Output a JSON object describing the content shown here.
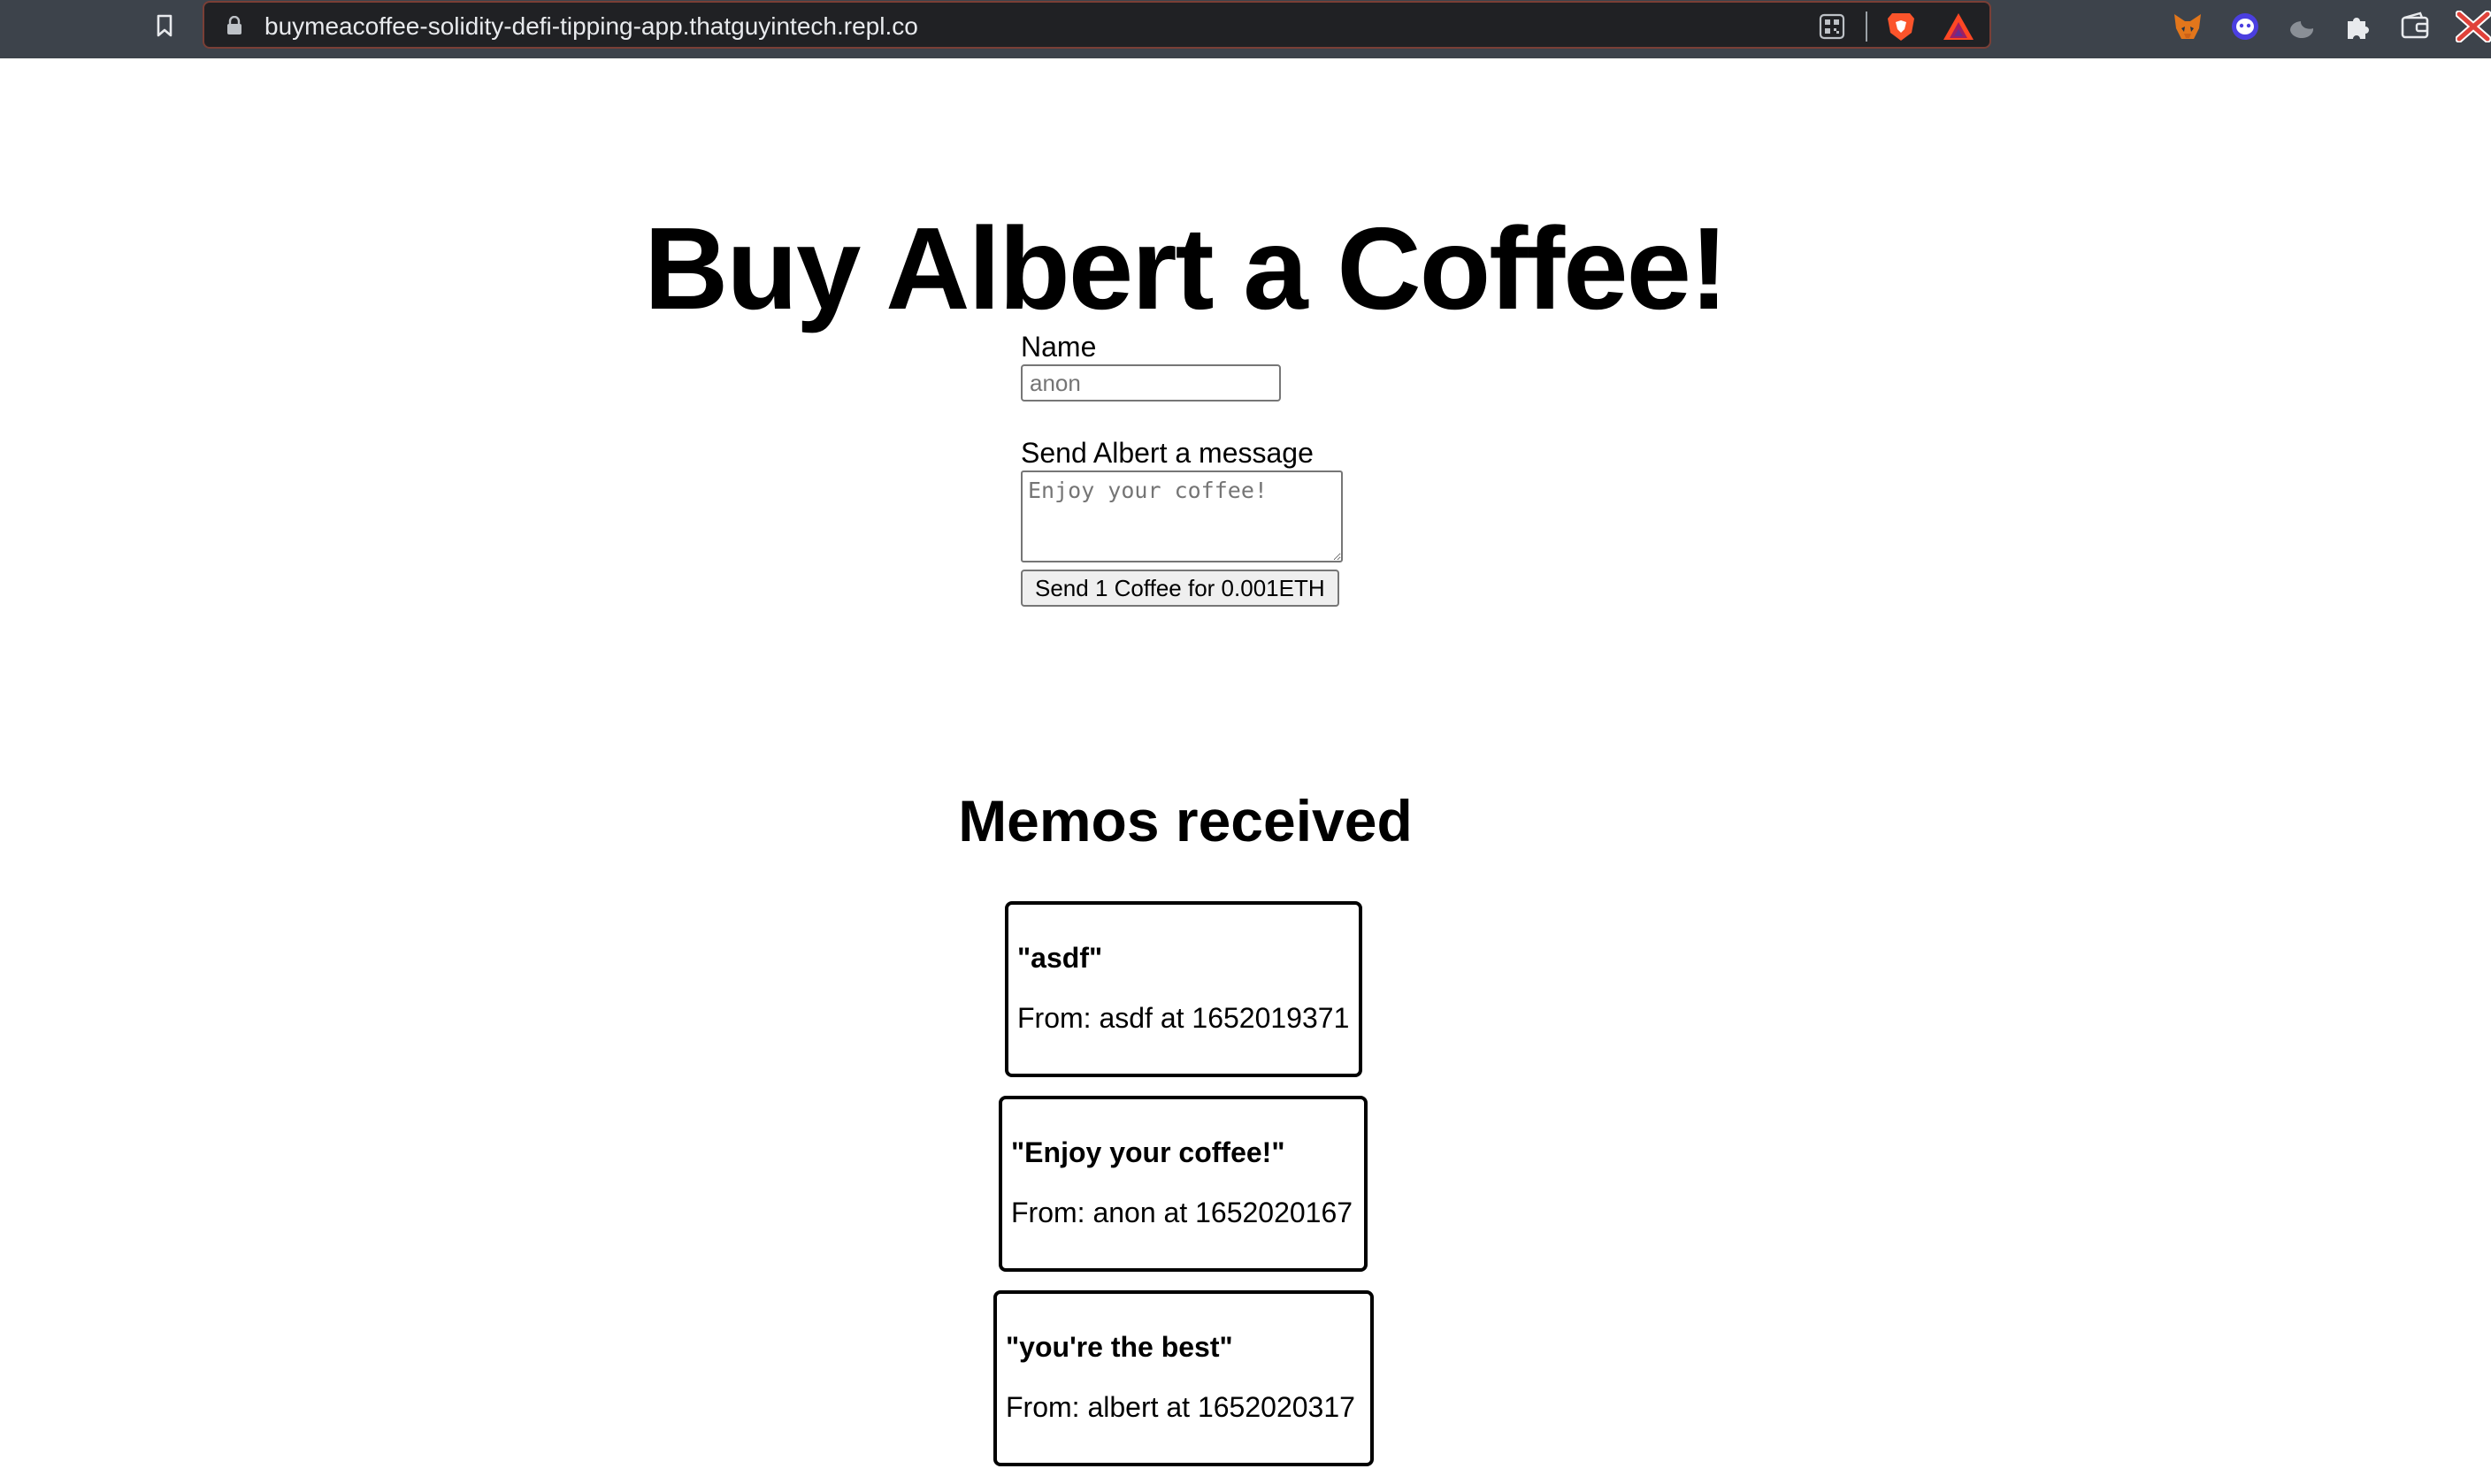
{
  "browser": {
    "url": "buymeacoffee-solidity-defi-tipping-app.thatguyintech.repl.co",
    "icons": [
      "bookmark-icon",
      "lock-icon",
      "qr-code-icon",
      "brave-shields-icon",
      "bat-rewards-icon",
      "metamask-fox-icon",
      "ghost-extension-icon",
      "moon-extension-icon",
      "extensions-puzzle-icon",
      "wallet-icon",
      "close-x-icon"
    ]
  },
  "page": {
    "title": "Buy Albert a Coffee!",
    "form": {
      "name_label": "Name",
      "name_placeholder": "anon",
      "message_label": "Send Albert a message",
      "message_placeholder": "Enjoy your coffee!",
      "send_button": "Send 1 Coffee for 0.001ETH"
    },
    "memos_heading": "Memos received",
    "memos": [
      {
        "message": "\"asdf\"",
        "from": "From: asdf at 1652019371"
      },
      {
        "message": "\"Enjoy your coffee!\"",
        "from": "From: anon at 1652020167"
      },
      {
        "message": "\"you're the best\"",
        "from": "From: albert at 1652020317"
      }
    ]
  },
  "colors": {
    "toolbar": "#3d434b",
    "urlbar": "#202124",
    "brave_orange": "#fb542b"
  }
}
